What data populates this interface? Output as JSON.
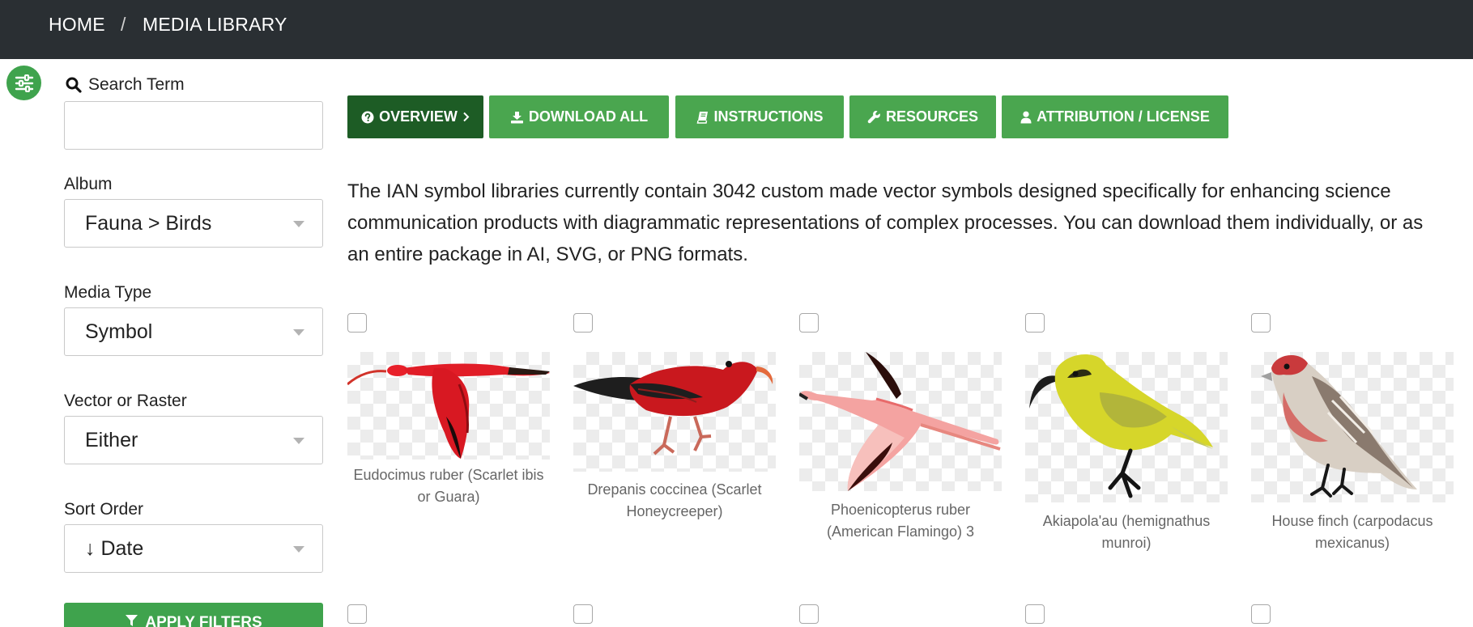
{
  "breadcrumb": {
    "home": "HOME",
    "separator": "/",
    "current": "MEDIA LIBRARY"
  },
  "sidebar": {
    "toggle_icon": "sliders-icon",
    "search": {
      "label": "Search Term",
      "value": "",
      "placeholder": ""
    },
    "album": {
      "label": "Album",
      "value": "Fauna > Birds"
    },
    "media_type": {
      "label": "Media Type",
      "value": "Symbol"
    },
    "vector_raster": {
      "label": "Vector or Raster",
      "value": "Either"
    },
    "sort_order": {
      "label": "Sort Order",
      "value": "↓ Date"
    },
    "apply_label": "APPLY FILTERS"
  },
  "tabs": [
    {
      "label": "OVERVIEW",
      "icon": "question-circle-icon",
      "active": true
    },
    {
      "label": "DOWNLOAD ALL",
      "icon": "download-icon",
      "active": false
    },
    {
      "label": "INSTRUCTIONS",
      "icon": "book-icon",
      "active": false
    },
    {
      "label": "RESOURCES",
      "icon": "wrench-icon",
      "active": false
    },
    {
      "label": "ATTRIBUTION / LICENSE",
      "icon": "user-icon",
      "active": false
    }
  ],
  "intro": "The IAN symbol libraries currently contain 3042 custom made vector symbols designed specifically for enhancing science communication products with diagrammatic representations of complex processes. You can download them individually, or as an entire package in AI, SVG, or PNG formats.",
  "items": [
    {
      "caption": "Eudocimus ruber (Scarlet ibis or Guara)",
      "checked": false
    },
    {
      "caption": "Drepanis coccinea (Scarlet Honeycreeper)",
      "checked": false
    },
    {
      "caption": "Phoenicopterus ruber (American Flamingo) 3",
      "checked": false
    },
    {
      "caption": "Akiapola'au (hemignathus munroi)",
      "checked": false
    },
    {
      "caption": "House finch (carpodacus mexicanus)",
      "checked": false
    }
  ],
  "colors": {
    "topbar": "#2a2f33",
    "accent": "#4aa64f",
    "active_tab": "#1d5c25"
  }
}
